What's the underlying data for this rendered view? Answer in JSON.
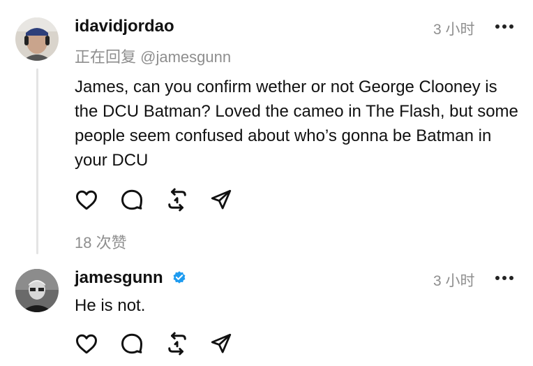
{
  "posts": [
    {
      "username": "idavidjordao",
      "timestamp": "3 小时",
      "reply_prefix": "正在回复",
      "reply_handle": "@jamesgunn",
      "text": "James, can you confirm wether or not George Clooney is the DCU Batman? Loved the cameo in The Flash, but some people seem confused about who’s gonna be Batman in your DCU",
      "likes": "18 次赞",
      "icons": [
        "heart-icon",
        "comment-icon",
        "repost-icon",
        "share-icon",
        "more-icon"
      ]
    },
    {
      "username": "jamesgunn",
      "verified": true,
      "timestamp": "3 小时",
      "text": "He is not.",
      "icons": [
        "heart-icon",
        "comment-icon",
        "repost-icon",
        "share-icon",
        "more-icon"
      ]
    }
  ],
  "colors": {
    "text": "#111111",
    "muted": "#8e8e8e",
    "verified_badge": "#1d9bf0",
    "thread_line": "#e4e4e4"
  }
}
